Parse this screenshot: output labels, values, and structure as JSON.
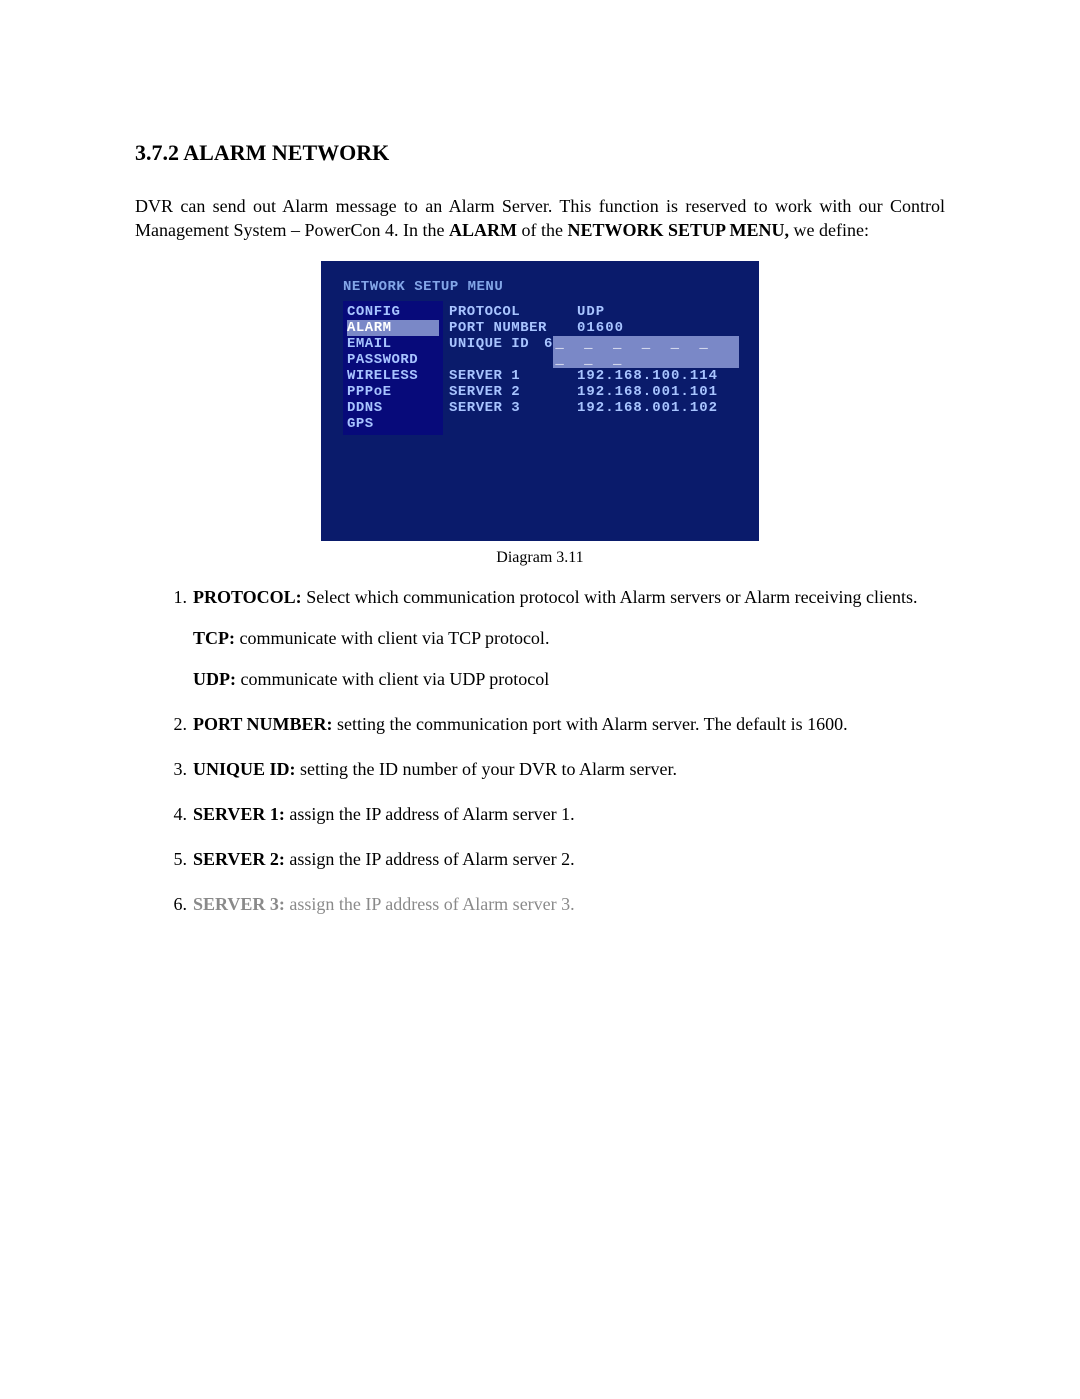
{
  "heading": "3.7.2 ALARM NETWORK",
  "intro": {
    "part1": "DVR can send out Alarm message to an Alarm Server. This function is reserved to work with our Control Management System – PowerCon 4. In the ",
    "bold1": "ALARM",
    "part2": " of the ",
    "bold2": "NETWORK SETUP MENU,",
    "part3": " we define:"
  },
  "dvr": {
    "title": "NETWORK SETUP MENU",
    "sidebar": [
      "CONFIG",
      "ALARM",
      "EMAIL",
      "PASSWORD",
      "WIRELESS",
      "PPPoE",
      "DDNS",
      "GPS"
    ],
    "highlight_index": 1,
    "rows": [
      {
        "k": "PROTOCOL",
        "v": "UDP"
      },
      {
        "k": "PORT NUMBER",
        "v": "01600"
      },
      {
        "k": "UNIQUE ID",
        "v": "6",
        "hv": "_ _ _ _ _ _ _ _ _"
      },
      {
        "k": "",
        "v": ""
      },
      {
        "k": "SERVER 1",
        "v": "192.168.100.114"
      },
      {
        "k": "SERVER 2",
        "v": "192.168.001.101"
      },
      {
        "k": "SERVER 3",
        "v": "192.168.001.102"
      }
    ]
  },
  "caption": "Diagram 3.11",
  "defs": [
    {
      "label": "PROTOCOL:",
      "text": " Select which communication protocol with Alarm servers or Alarm receiving clients.",
      "subs": [
        {
          "label": "TCP:",
          "text": " communicate with client via TCP protocol."
        },
        {
          "label": "UDP:",
          "text": " communicate with client via UDP protocol"
        }
      ]
    },
    {
      "label": "PORT NUMBER:",
      "text": " setting the communication port with Alarm server. The default is 1600."
    },
    {
      "label": "UNIQUE ID:",
      "text": " setting the ID number of your DVR to Alarm server."
    },
    {
      "label": "SERVER 1:",
      "text": " assign the IP address of Alarm server 1."
    },
    {
      "label": "SERVER 2:",
      "text": " assign the IP address of Alarm server 2."
    },
    {
      "label": "SERVER 3:",
      "text": " assign the IP address of Alarm server 3.",
      "faded": true
    }
  ]
}
